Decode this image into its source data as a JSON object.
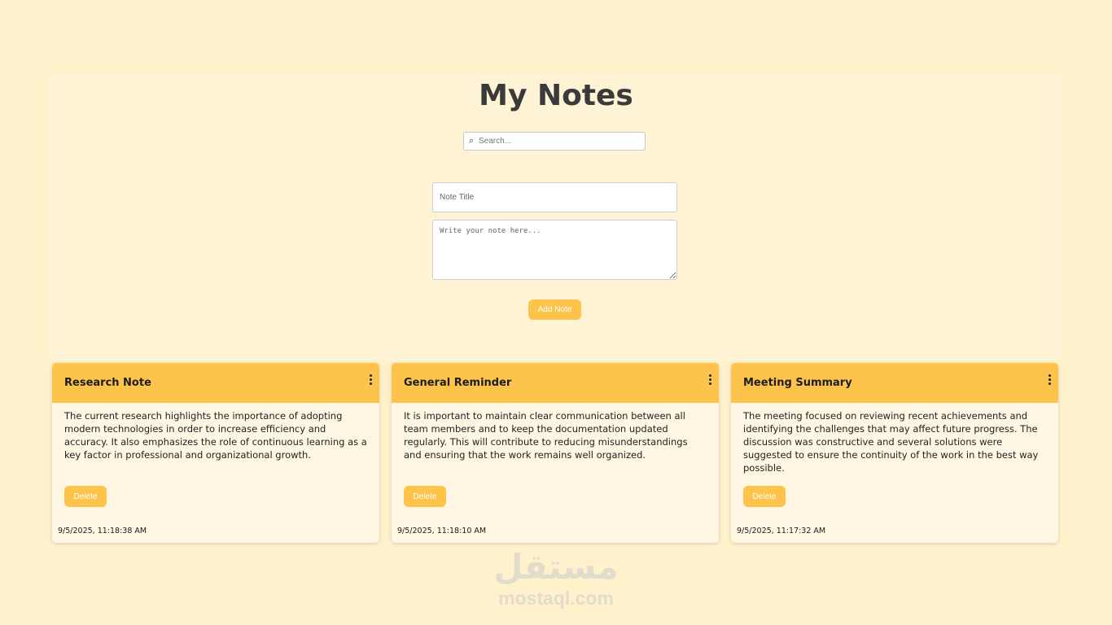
{
  "header": {
    "title": "My Notes"
  },
  "search": {
    "icon": "search-icon",
    "placeholder": "Search..."
  },
  "form": {
    "title_placeholder": "Note Title",
    "body_placeholder": "Write your note here...",
    "add_label": "Add Note"
  },
  "notes": [
    {
      "title": "Research Note",
      "body": "The current research highlights the importance of adopting modern technologies in order to increase efficiency and accuracy. It also emphasizes the role of continuous learning as a key factor in professional and organizational growth.",
      "delete_label": "Delete",
      "timestamp": "9/5/2025, 11:18:38 AM"
    },
    {
      "title": "General Reminder",
      "body": "It is important to maintain clear communication between all team members and to keep the documentation updated regularly. This will contribute to reducing misunderstandings and ensuring that the work remains well organized.",
      "delete_label": "Delete",
      "timestamp": "9/5/2025, 11:18:10 AM"
    },
    {
      "title": "Meeting Summary",
      "body": "The meeting focused on reviewing recent achievements and identifying the challenges that may affect future progress. The discussion was constructive and several solutions were suggested to ensure the continuity of the work in the best way possible.",
      "delete_label": "Delete",
      "timestamp": "9/5/2025, 11:17:32 AM"
    }
  ],
  "watermark": {
    "arabic": "مستقل",
    "latin": "mostaql.com"
  },
  "colors": {
    "background": "#fff1cc",
    "accent": "#fec34a",
    "card_body": "#fff7e4",
    "title_text": "#3a3a3a"
  }
}
